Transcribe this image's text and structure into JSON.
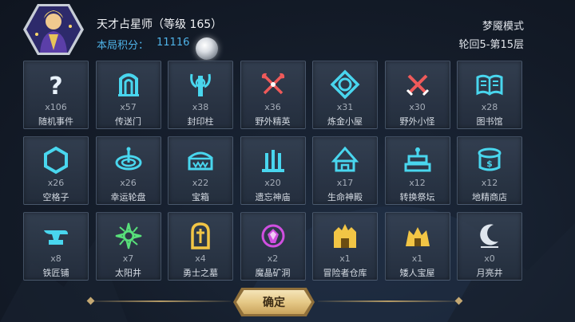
{
  "header": {
    "player_name": "天才占星师（等级 165）",
    "score_label": "本局积分：",
    "score_value": "11116",
    "mode": "梦魇模式",
    "cycle": "轮回5-第15层"
  },
  "tiles": [
    {
      "count": "x106",
      "name": "随机事件",
      "icon": "question-icon",
      "color": "#e9f2fb"
    },
    {
      "count": "x57",
      "name": "传送门",
      "icon": "portal-icon",
      "color": "#49d6ee"
    },
    {
      "count": "x38",
      "name": "封印柱",
      "icon": "seal-pillar-icon",
      "color": "#49d6ee"
    },
    {
      "count": "x36",
      "name": "野外精英",
      "icon": "elite-axes-icon",
      "color": "#ef5a5a"
    },
    {
      "count": "x31",
      "name": "炼金小屋",
      "icon": "alchemy-icon",
      "color": "#49d6ee"
    },
    {
      "count": "x30",
      "name": "野外小怪",
      "icon": "crossed-swords-icon",
      "color": "#ef5a5a"
    },
    {
      "count": "x28",
      "name": "图书馆",
      "icon": "book-icon",
      "color": "#49d6ee"
    },
    {
      "count": "x26",
      "name": "空格子",
      "icon": "hexagon-icon",
      "color": "#49d6ee"
    },
    {
      "count": "x26",
      "name": "幸运轮盘",
      "icon": "wheel-icon",
      "color": "#49d6ee"
    },
    {
      "count": "x22",
      "name": "宝箱",
      "icon": "chest-icon",
      "color": "#49d6ee"
    },
    {
      "count": "x20",
      "name": "遗忘神庙",
      "icon": "temple-icon",
      "color": "#49d6ee"
    },
    {
      "count": "x17",
      "name": "生命神殿",
      "icon": "shrine-icon",
      "color": "#49d6ee"
    },
    {
      "count": "x12",
      "name": "转换祭坛",
      "icon": "altar-icon",
      "color": "#49d6ee"
    },
    {
      "count": "x12",
      "name": "地精商店",
      "icon": "shop-icon",
      "color": "#49d6ee"
    },
    {
      "count": "x8",
      "name": "铁匠铺",
      "icon": "anvil-icon",
      "color": "#49d6ee"
    },
    {
      "count": "x7",
      "name": "太阳井",
      "icon": "sun-well-icon",
      "color": "#58e07a"
    },
    {
      "count": "x4",
      "name": "勇士之墓",
      "icon": "tomb-icon",
      "color": "#f2c545"
    },
    {
      "count": "x2",
      "name": "魔晶矿洞",
      "icon": "crystal-mine-icon",
      "color": "#d04fe0"
    },
    {
      "count": "x1",
      "name": "冒险者仓库",
      "icon": "warehouse-icon",
      "color": "#f2c545"
    },
    {
      "count": "x1",
      "name": "矮人宝屋",
      "icon": "dwarf-vault-icon",
      "color": "#f2c545"
    },
    {
      "count": "x0",
      "name": "月亮井",
      "icon": "moon-well-icon",
      "color": "#dfe6ee"
    }
  ],
  "footer": {
    "confirm_label": "确定"
  }
}
